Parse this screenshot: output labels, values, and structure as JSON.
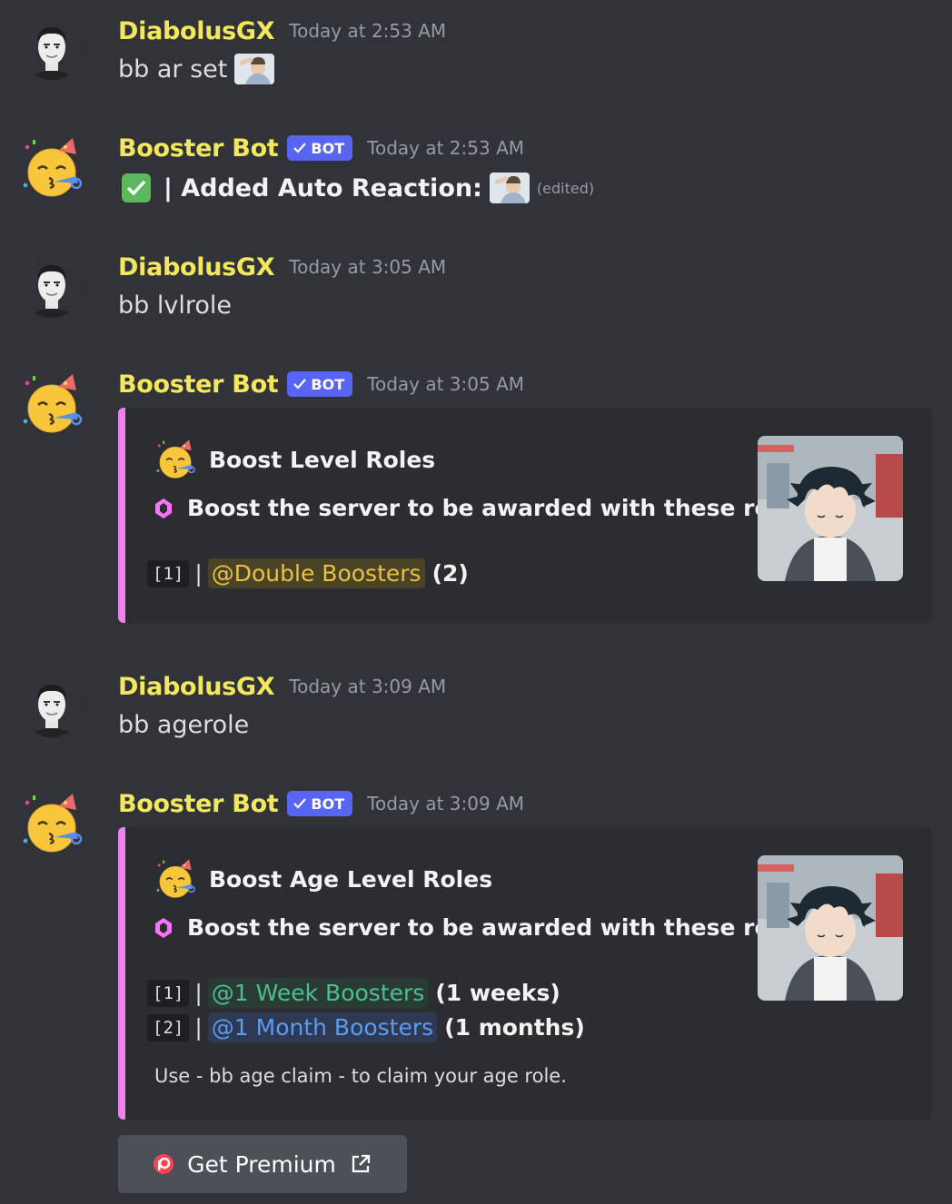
{
  "colors": {
    "accent": "#5865f2",
    "username": "#f2e75d",
    "embed_border": "#ee82ee"
  },
  "messages": [
    {
      "user": "DiabolusGX",
      "time": "Today at 2:53 AM",
      "text": "bb ar set"
    },
    {
      "user": "Booster Bot",
      "badge": "BOT",
      "time": "Today at 2:53 AM",
      "text": "| Added Auto Reaction:",
      "edited": "(edited)"
    },
    {
      "user": "DiabolusGX",
      "time": "Today at 3:05 AM",
      "text": "bb lvlrole"
    },
    {
      "user": "Booster Bot",
      "badge": "BOT",
      "time": "Today at 3:05 AM",
      "embed": {
        "title": "Boost Level Roles",
        "description": "Boost the server to be awarded with these roles!",
        "rows": [
          {
            "index": "[1]",
            "sep": "|",
            "role": "@Double Boosters",
            "extra": "(2)"
          }
        ]
      }
    },
    {
      "user": "DiabolusGX",
      "time": "Today at 3:09 AM",
      "text": "bb agerole"
    },
    {
      "user": "Booster Bot",
      "badge": "BOT",
      "time": "Today at 3:09 AM",
      "embed": {
        "title": "Boost Age Level Roles",
        "description": "Boost the server to be awarded with these roles!",
        "rows": [
          {
            "index": "[1]",
            "sep": "|",
            "role": "@1 Week Boosters",
            "extra": "(1 weeks)"
          },
          {
            "index": "[2]",
            "sep": "|",
            "role": "@1 Month Boosters",
            "extra": "(1 months)"
          }
        ],
        "footer": "Use - bb age claim - to claim your age role."
      }
    }
  ],
  "button": {
    "label": "Get Premium",
    "icon": "patreon-icon",
    "trailing_icon": "external-link-icon"
  }
}
